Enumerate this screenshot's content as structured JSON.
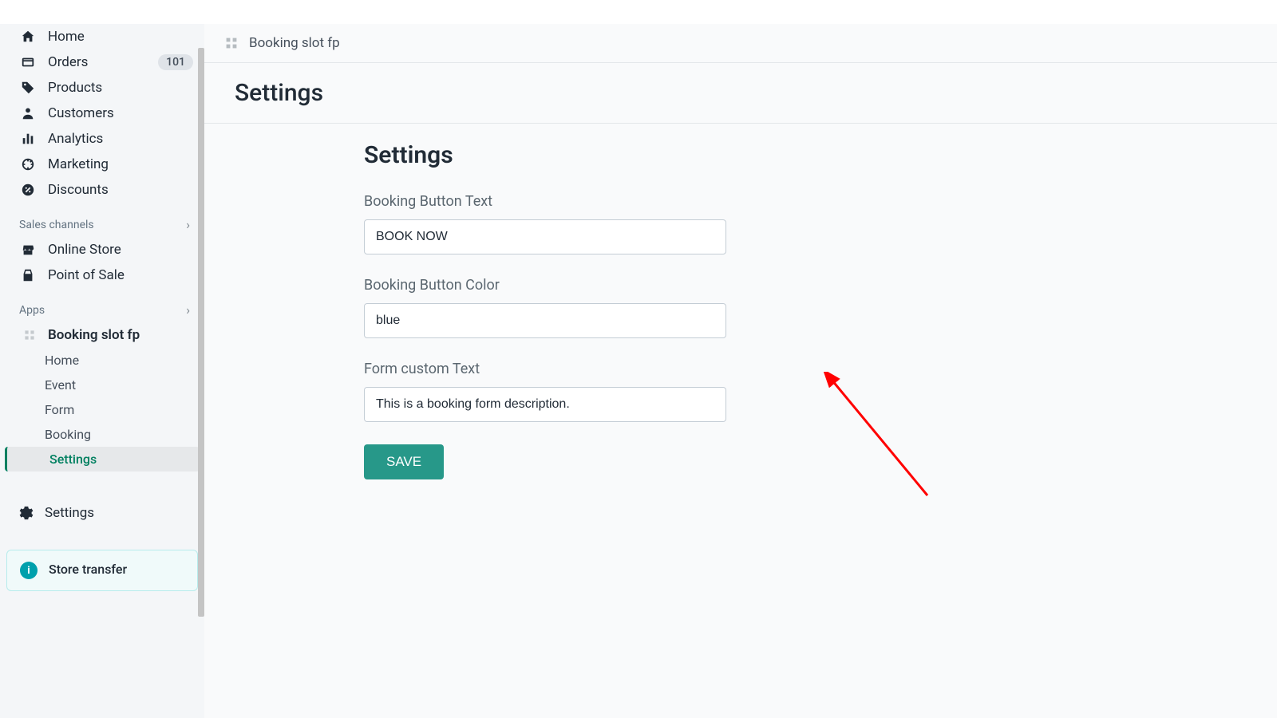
{
  "sidebar": {
    "items": [
      {
        "label": "Home"
      },
      {
        "label": "Orders",
        "badge": "101"
      },
      {
        "label": "Products"
      },
      {
        "label": "Customers"
      },
      {
        "label": "Analytics"
      },
      {
        "label": "Marketing"
      },
      {
        "label": "Discounts"
      }
    ],
    "sales_channels_heading": "Sales channels",
    "channels": [
      {
        "label": "Online Store"
      },
      {
        "label": "Point of Sale"
      }
    ],
    "apps_heading": "Apps",
    "app": {
      "name": "Booking slot fp",
      "items": [
        {
          "label": "Home"
        },
        {
          "label": "Event"
        },
        {
          "label": "Form"
        },
        {
          "label": "Booking"
        },
        {
          "label": "Settings",
          "active": true
        }
      ]
    },
    "settings_label": "Settings",
    "info_card_text": "Store transfer"
  },
  "breadcrumb": {
    "app_name": "Booking slot fp"
  },
  "page": {
    "title_bar": "Settings",
    "heading": "Settings",
    "fields": {
      "button_text_label": "Booking Button Text",
      "button_text_value": "BOOK NOW",
      "button_color_label": "Booking Button Color",
      "button_color_value": "blue",
      "form_text_label": "Form custom Text",
      "form_text_value": "This is a booking form description."
    },
    "save_label": "SAVE"
  },
  "colors": {
    "accent": "#279889"
  }
}
